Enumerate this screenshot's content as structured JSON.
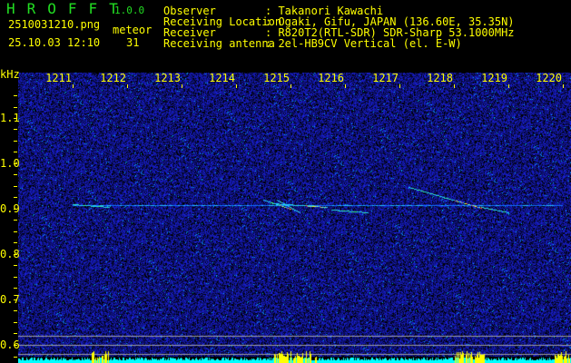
{
  "header": {
    "app_title": "HROFFT",
    "version": "1.0.0",
    "filename": "2510031210.png",
    "datetime": "25.10.03 12:10",
    "count_label": "meteor",
    "count_value": "31",
    "info": [
      {
        "label": "Observer",
        "value": ": Takanori Kawachi"
      },
      {
        "label": "Receiving Location",
        "value": ": Ogaki, Gifu, JAPAN (136.60E, 35.35N)"
      },
      {
        "label": "Receiver",
        "value": ": R820T2(RTL-SDR) SDR-Sharp 53.1000MHz"
      },
      {
        "label": "Receiving antenna",
        "value": ": 2el-HB9CV Vertical (el. E-W)"
      }
    ]
  },
  "axis": {
    "y_unit": "kHz",
    "x_ticks": [
      "1211",
      "1212",
      "1213",
      "1214",
      "1215",
      "1216",
      "1217",
      "1218",
      "1219",
      "1220"
    ],
    "y_ticks": [
      {
        "label": "1.1",
        "value": 1.1
      },
      {
        "label": "1.0",
        "value": 1.0
      },
      {
        "label": "0.9",
        "value": 0.9
      },
      {
        "label": "0.8",
        "value": 0.8
      },
      {
        "label": "0.7",
        "value": 0.7
      },
      {
        "label": "0.6",
        "value": 0.6
      }
    ]
  },
  "colors": {
    "text": "#ffff00",
    "title": "#22dd22",
    "noise": "#1a2ad0",
    "level": "#00ffff",
    "burst": "#ffff00"
  }
}
